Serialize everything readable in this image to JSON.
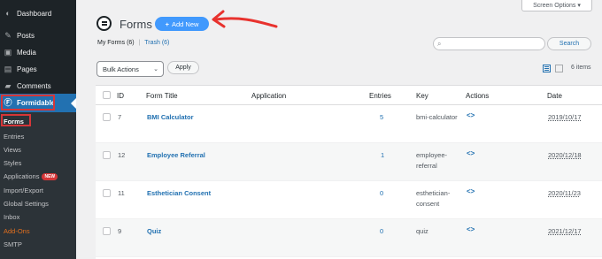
{
  "sidebar": {
    "items": [
      {
        "label": "Dashboard",
        "icon": "dashboard-icon"
      },
      {
        "label": "Posts",
        "icon": "pushpin-icon"
      },
      {
        "label": "Media",
        "icon": "media-icon"
      },
      {
        "label": "Pages",
        "icon": "pages-icon"
      },
      {
        "label": "Comments",
        "icon": "comments-icon"
      },
      {
        "label": "Formidable",
        "icon": "formidable-icon"
      }
    ],
    "submenu": [
      {
        "label": "Forms"
      },
      {
        "label": "Entries"
      },
      {
        "label": "Views"
      },
      {
        "label": "Styles"
      },
      {
        "label": "Applications",
        "badge": "NEW"
      },
      {
        "label": "Import/Export"
      },
      {
        "label": "Global Settings"
      },
      {
        "label": "Inbox"
      },
      {
        "label": "Add-Ons"
      },
      {
        "label": "SMTP"
      }
    ]
  },
  "header": {
    "title": "Forms",
    "add_new_label": "Add New",
    "screen_options_label": "Screen Options ▾"
  },
  "filters": {
    "my_forms": "My Forms",
    "my_forms_count": "(6)",
    "separator": "|",
    "trash": "Trash",
    "trash_count": "(6)"
  },
  "search": {
    "button_label": "Search",
    "placeholder": ""
  },
  "bulk": {
    "selected": "Bulk Actions",
    "apply_label": "Apply"
  },
  "items_count": "6 items",
  "table": {
    "columns": [
      "ID",
      "Form Title",
      "Application",
      "Entries",
      "Key",
      "Actions",
      "Date"
    ],
    "rows": [
      {
        "id": "7",
        "title": "BMI Calculator",
        "application": "",
        "entries": "5",
        "key": "bmi-calculator",
        "actions": "<>",
        "date": "2019/10/17"
      },
      {
        "id": "12",
        "title": "Employee Referral",
        "application": "",
        "entries": "1",
        "key": "employee-referral",
        "actions": "<>",
        "date": "2020/12/18"
      },
      {
        "id": "11",
        "title": "Esthetician Consent",
        "application": "",
        "entries": "0",
        "key": "esthetician-consent",
        "actions": "<>",
        "date": "2020/11/23"
      },
      {
        "id": "9",
        "title": "Quiz",
        "application": "",
        "entries": "0",
        "key": "quiz",
        "actions": "<>",
        "date": "2021/12/17"
      }
    ]
  },
  "colors": {
    "accent": "#2271b1",
    "add_new_button": "#4199fd",
    "highlight_box": "#d63638",
    "arrow": "#e8322e",
    "sidebar_bg": "#1d2327",
    "addons_text": "#e26f1e"
  }
}
